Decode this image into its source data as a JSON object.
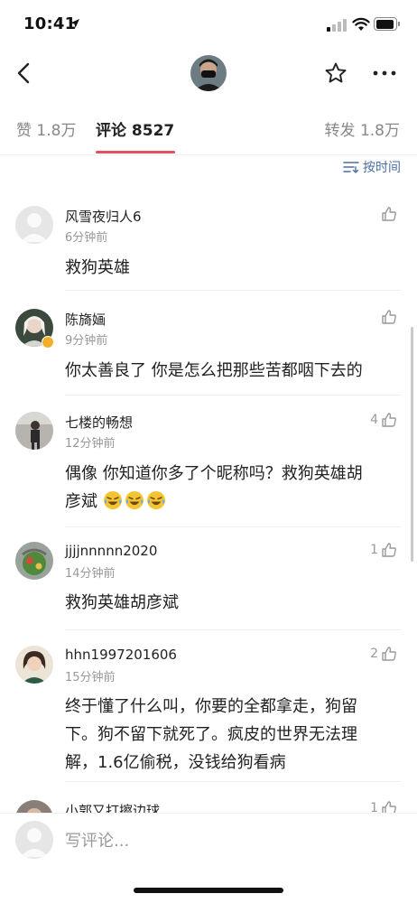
{
  "status_bar": {
    "time": "10:41"
  },
  "nav": {
    "back_icon": "chevron-left-icon",
    "star_icon": "star-outline-icon",
    "more_icon": "more-horizontal-icon"
  },
  "tabs": {
    "likes": "赞 1.8万",
    "comments": "评论 8527",
    "reposts": "转发 1.8万",
    "active_color": "#e5505e"
  },
  "sort": {
    "label": "按时间",
    "color": "#4a6fa5"
  },
  "comments": [
    {
      "username": "风雪夜归人6",
      "time": "6分钟前",
      "likes": "",
      "lines": [
        "救狗英雄"
      ]
    },
    {
      "username": "陈旖婳",
      "time": "9分钟前",
      "likes": "",
      "lines": [
        "你太善良了 你是怎么把那些苦都咽下去的"
      ]
    },
    {
      "username": "七楼的畅想",
      "time": "12分钟前",
      "likes": "4",
      "lines": [
        "偶像 你知道你多了个昵称吗？救狗英雄胡",
        "彦斌"
      ]
    },
    {
      "username": "jjjjnnnnn2020",
      "time": "14分钟前",
      "likes": "1",
      "lines": [
        "救狗英雄胡彦斌"
      ]
    },
    {
      "username": "hhn1997201606",
      "time": "15分钟前",
      "likes": "2",
      "lines": [
        "终于懂了什么叫，你要的全都拿走，狗留",
        "下。狗不留下就死了。疯皮的世界无法理",
        "解，1.6亿偷税，没钱给狗看病"
      ]
    },
    {
      "username": "小郭又打擦边球",
      "time": "",
      "likes": "1",
      "lines": []
    }
  ],
  "input": {
    "placeholder": "写评论..."
  }
}
